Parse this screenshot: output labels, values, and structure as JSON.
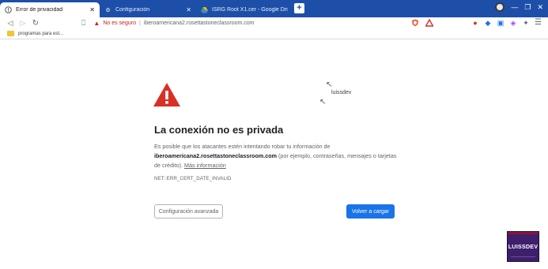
{
  "browser": {
    "tabs": [
      {
        "label": "Error de privacidad",
        "icon": "warning-circle-icon",
        "active": true
      },
      {
        "label": "Configuración",
        "icon": "gear-icon",
        "active": false
      },
      {
        "label": "ISRG Root X1.cer - Google Drive",
        "icon": "google-drive-icon",
        "active": false
      }
    ],
    "new_tab": "+",
    "security_label": "No es seguro",
    "url": "iberoamericana2.rosettastoneclassroom.com",
    "bookmark": "programas para est...",
    "colors": {
      "tabstrip": "#1d4fa8",
      "warning_red": "#d93025",
      "primary_blue": "#1a73e8"
    }
  },
  "page": {
    "title": "La conexión no es privada",
    "body_prefix": "Es posible que los atacantes estén intentando robar tu información de",
    "domain": "iberoamericana2.rosettastoneclassroom.com",
    "body_suffix": "(por ejemplo, contraseñas, mensajes o tarjetas de crédito).",
    "more_link": "Más información",
    "error_code": "NET::ERR_CERT_DATE_INVALID",
    "advanced_button": "Configuración avanzada",
    "back_button": "Volver a cargar"
  },
  "overlay": {
    "username": "luissdev",
    "logo_text": "LUISSDEV"
  }
}
